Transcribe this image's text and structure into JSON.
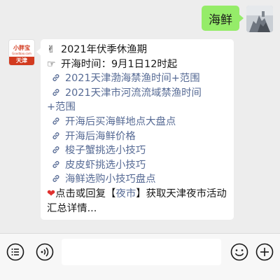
{
  "sent": {
    "text": "海鲜"
  },
  "bot_avatar": {
    "brand": "小胖宝",
    "url": "Goodbao.com",
    "city": "天津"
  },
  "reply": {
    "title": "2021年伏季休渔期",
    "open_time": "开海时间：9月1日12时起",
    "links": [
      "2021天津渤海禁渔时间+范围",
      "2021天津市河流流域禁渔时间",
      "开海后买海鲜地点大盘点",
      "开海后海鲜价格",
      "梭子蟹挑选小技巧",
      "皮皮虾挑选小技巧",
      "海鲜选购小技巧盘点"
    ],
    "link_continuation": "+范围",
    "footer_pre": "点击或回复【",
    "footer_keyword": "夜市",
    "footer_post": "】获取天津夜市活动汇总详情..."
  },
  "icons": {
    "voice": "voice-icon",
    "link": "link-icon",
    "emoji": "emoji-icon",
    "more": "plus-icon",
    "menu": "menu-icon"
  },
  "colors": {
    "sent_bubble": "#95ec69",
    "link": "#576b95",
    "chat_bg": "#ededed"
  }
}
